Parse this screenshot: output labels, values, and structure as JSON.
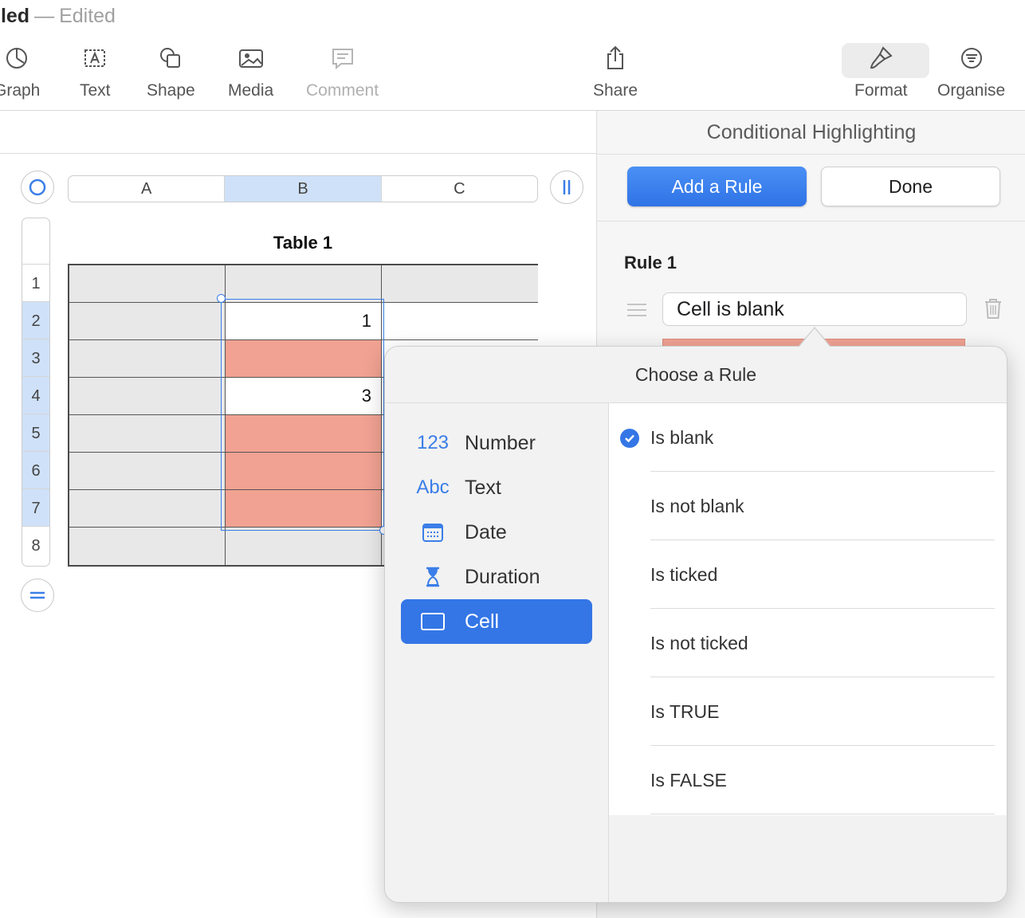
{
  "window": {
    "title": "lled",
    "separator": "—",
    "status": "Edited"
  },
  "toolbar": {
    "items": [
      {
        "label": "Graph",
        "icon": "graph-icon"
      },
      {
        "label": "Text",
        "icon": "text-box-icon"
      },
      {
        "label": "Shape",
        "icon": "shape-icon"
      },
      {
        "label": "Media",
        "icon": "media-icon"
      },
      {
        "label": "Comment",
        "icon": "comment-icon",
        "disabled": true
      },
      {
        "label": "Share",
        "icon": "share-icon"
      },
      {
        "label": "Format",
        "icon": "paintbrush-icon",
        "active": true
      },
      {
        "label": "Organise",
        "icon": "organise-icon"
      }
    ]
  },
  "sheet": {
    "table_title": "Table 1",
    "columns": [
      "A",
      "B",
      "C"
    ],
    "selected_column": "B",
    "rows": [
      "1",
      "2",
      "3",
      "4",
      "5",
      "6",
      "7",
      "8"
    ],
    "selected_rows": [
      "2",
      "3",
      "4",
      "5",
      "6",
      "7"
    ],
    "cells": {
      "B2": "1",
      "B4": "3"
    },
    "highlight_color": "#f1a292",
    "header_fill": "#e8e8e8"
  },
  "sidebar": {
    "title": "Conditional Highlighting",
    "add_rule_label": "Add a Rule",
    "done_label": "Done",
    "rule_label": "Rule 1",
    "rule_value": "Cell is blank",
    "accent": "#3476e6"
  },
  "popover": {
    "title": "Choose a Rule",
    "categories": [
      {
        "label": "Number",
        "glyph": "123"
      },
      {
        "label": "Text",
        "glyph": "Abc"
      },
      {
        "label": "Date",
        "glyph": ""
      },
      {
        "label": "Duration",
        "glyph": ""
      },
      {
        "label": "Cell",
        "glyph": "",
        "active": true
      }
    ],
    "options": [
      {
        "label": "Is blank",
        "checked": true
      },
      {
        "label": "Is not blank"
      },
      {
        "label": "Is ticked"
      },
      {
        "label": "Is not ticked"
      },
      {
        "label": "Is TRUE"
      },
      {
        "label": "Is FALSE"
      }
    ]
  }
}
